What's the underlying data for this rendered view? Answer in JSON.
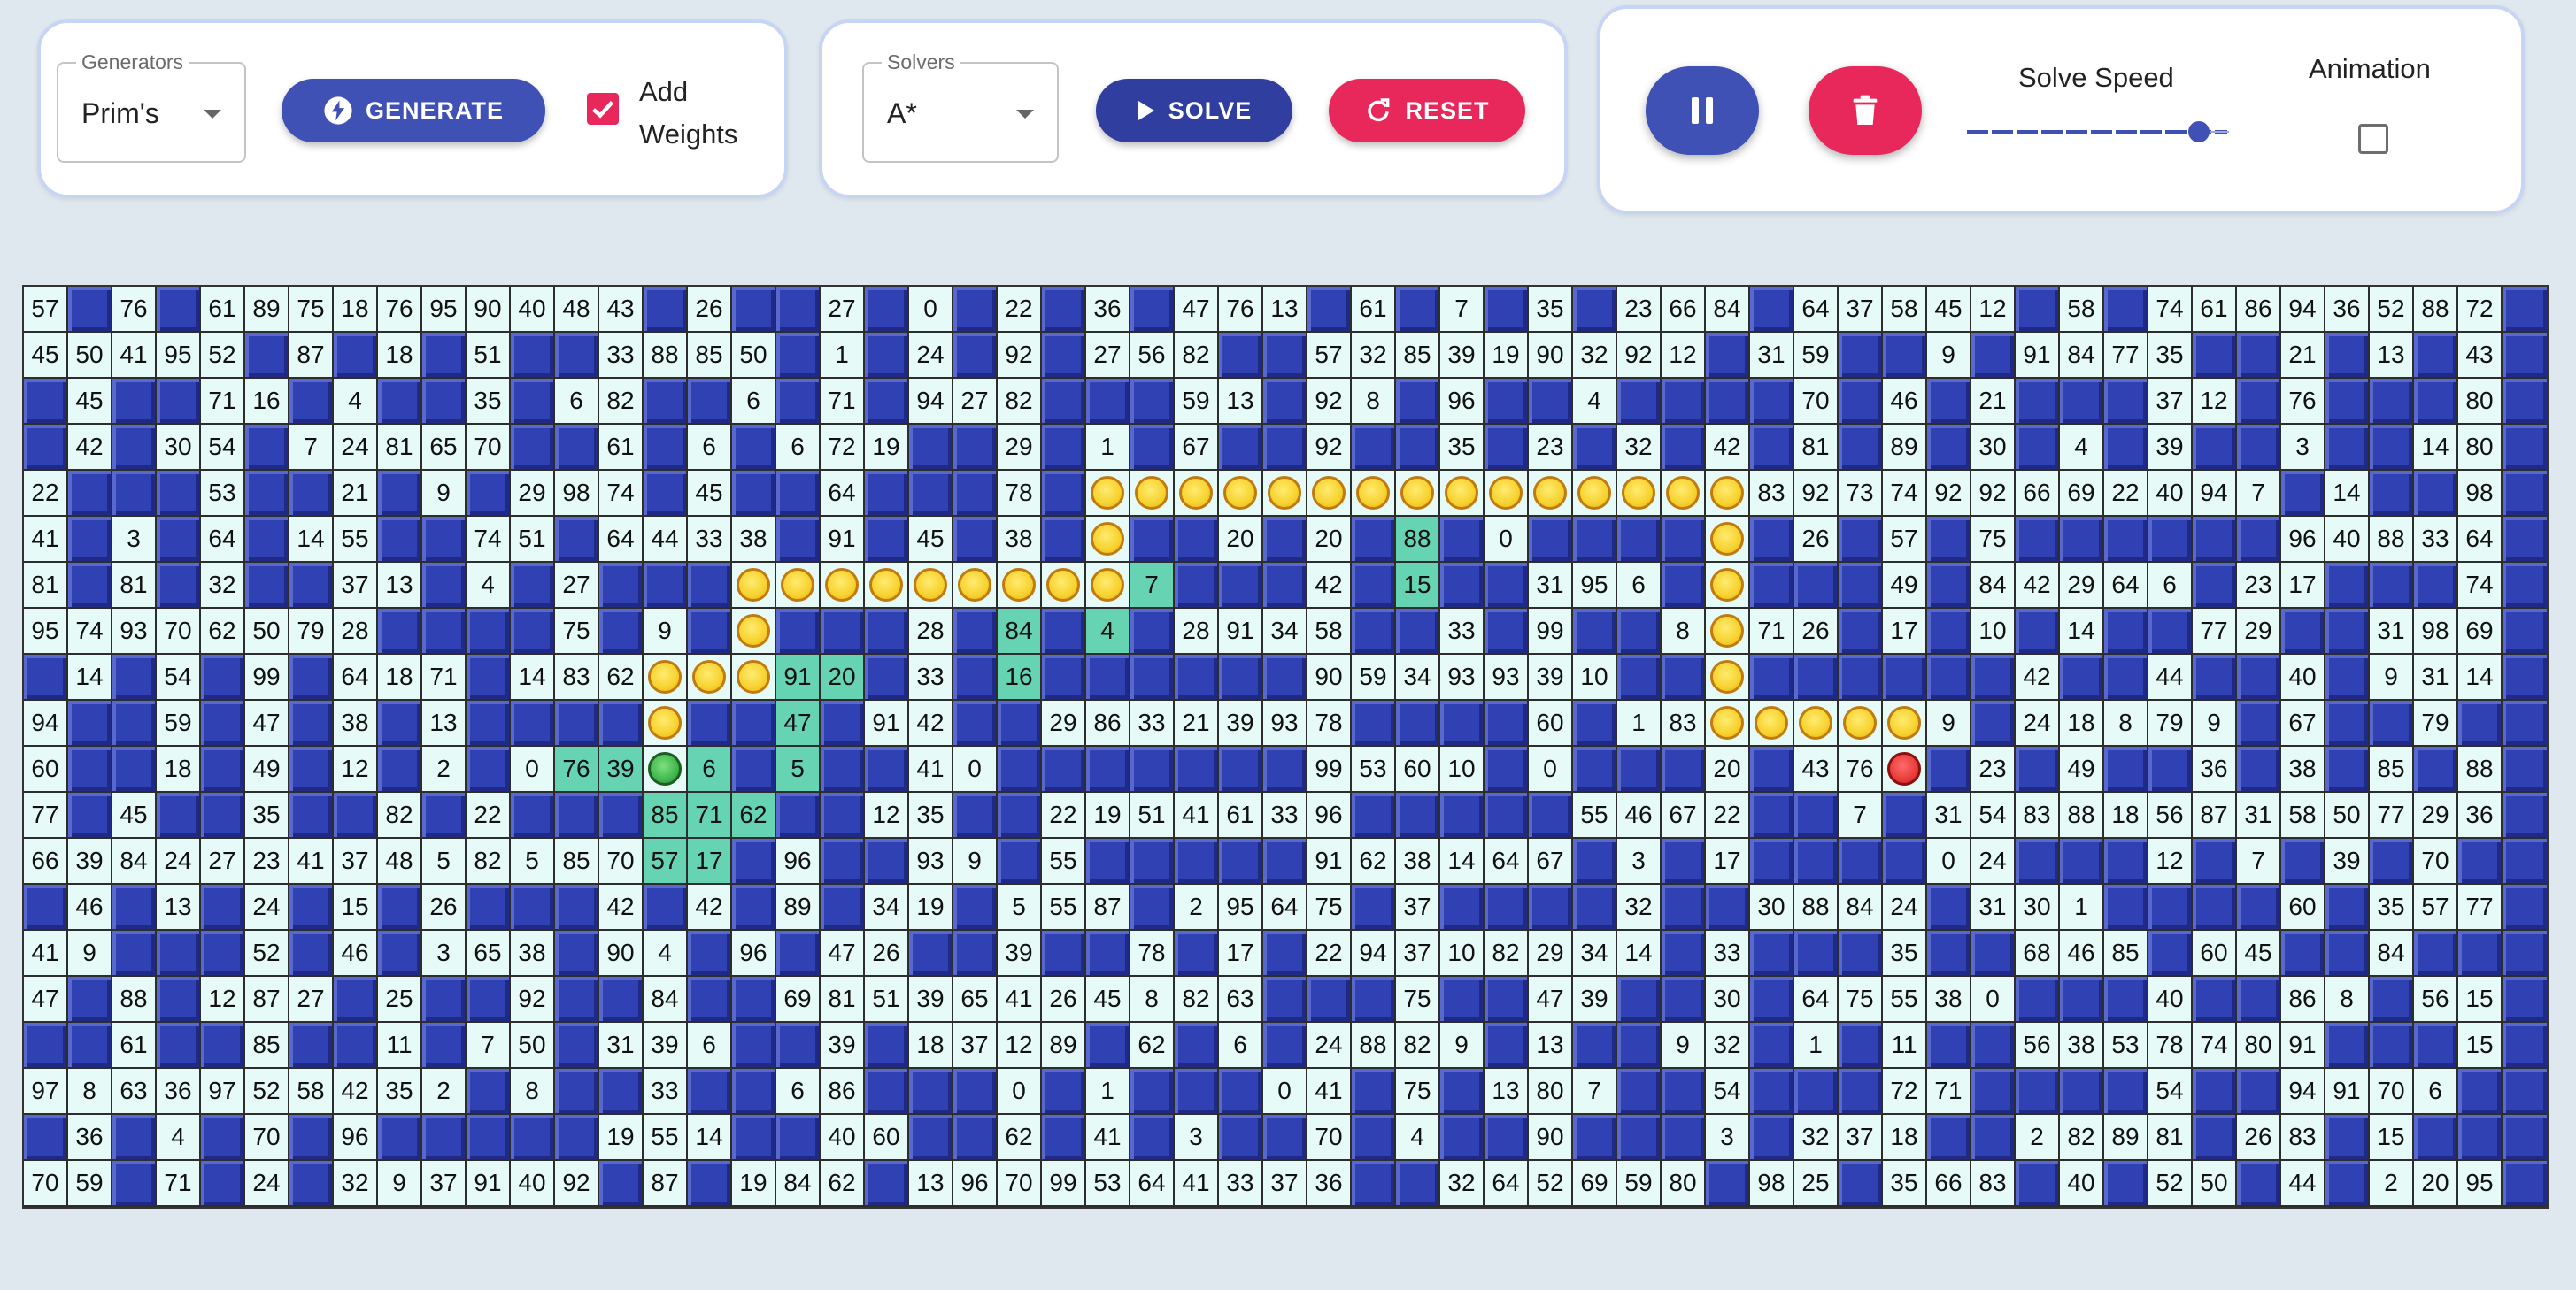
{
  "generators": {
    "legend": "Generators",
    "selected": "Prim's",
    "generate_label": "GENERATE",
    "add_weights_label_line1": "Add",
    "add_weights_label_line2": "Weights",
    "add_weights_checked": true
  },
  "solvers": {
    "legend": "Solvers",
    "selected": "A*",
    "solve_label": "SOLVE",
    "reset_label": "RESET"
  },
  "controls": {
    "pause_icon": "pause-icon",
    "delete_icon": "trash-icon",
    "solve_speed_label": "Solve Speed",
    "solve_speed_value": 0.93,
    "animation_label": "Animation",
    "animation_checked": false
  },
  "colors": {
    "primary": "#3f51b5",
    "secondary": "#e8285a",
    "wall": "#2f41b3",
    "open": "#e6fbf8",
    "visited": "#66d4b2",
    "path": "#f7d22e",
    "start": "#3db34a",
    "end": "#e53935"
  },
  "grid": {
    "cols": 57,
    "legend": {
      "#": "wall",
      "~": "visited cell",
      "o": "path marker",
      "S": "start",
      "E": "end"
    },
    "rows": [
      [
        "57",
        "#",
        "76",
        "#",
        "61",
        "89",
        "75",
        "18",
        "76",
        "95",
        "90",
        "40",
        "48",
        "43",
        "#",
        "26",
        "#",
        "#",
        "27",
        "#",
        "0",
        "#",
        "22",
        "#",
        "36",
        "#",
        "47",
        "76",
        "13",
        "#",
        "61",
        "#",
        "7",
        "#",
        "35",
        "#",
        "23",
        "66",
        "84",
        "#",
        "64",
        "37",
        "58",
        "45",
        "12",
        "#",
        "58",
        "#",
        "74",
        "61",
        "86",
        "94",
        "36",
        "52",
        "88",
        "72"
      ],
      [
        "45",
        "50",
        "41",
        "95",
        "52",
        "#",
        "87",
        "#",
        "18",
        "#",
        "51",
        "#",
        "#",
        "33",
        "88",
        "85",
        "50",
        "#",
        "1",
        "#",
        "24",
        "#",
        "92",
        "#",
        "27",
        "56",
        "82",
        "#",
        "#",
        "57",
        "32",
        "85",
        "39",
        "19",
        "90",
        "32",
        "92",
        "12",
        "#",
        "31",
        "59",
        "#",
        "#",
        "9",
        "#",
        "91",
        "84",
        "77",
        "35",
        "#",
        "#",
        "21",
        "#",
        "13",
        "#",
        "43"
      ],
      [
        "#",
        "45",
        "#",
        "#",
        "71",
        "16",
        "#",
        "4",
        "#",
        "#",
        "35",
        "#",
        "6",
        "82",
        "#",
        "#",
        "6",
        "#",
        "71",
        "#",
        "94",
        "27",
        "82",
        "#",
        "#",
        "#",
        "59",
        "13",
        "#",
        "92",
        "8",
        "#",
        "96",
        "#",
        "#",
        "4",
        "#",
        "#",
        "#",
        "#",
        "70",
        "#",
        "46",
        "#",
        "21",
        "#",
        "#",
        "#",
        "37",
        "12",
        "#",
        "76",
        "#",
        "#",
        "#",
        "80"
      ],
      [
        "#",
        "42",
        "#",
        "30",
        "54",
        "#",
        "7",
        "24",
        "81",
        "65",
        "70",
        "#",
        "#",
        "61",
        "#",
        "6",
        "#",
        "6",
        "72",
        "19",
        "#",
        "#",
        "29",
        "#",
        "1",
        "#",
        "67",
        "#",
        "#",
        "92",
        "#",
        "#",
        "35",
        "#",
        "23",
        "#",
        "32",
        "#",
        "42",
        "#",
        "81",
        "#",
        "89",
        "#",
        "30",
        "#",
        "4",
        "#",
        "39",
        "#",
        "#",
        "3",
        "#",
        "#",
        "14",
        "80"
      ],
      [
        "22",
        "#",
        "#",
        "#",
        "53",
        "#",
        "#",
        "21",
        "#",
        "9",
        "#",
        "29",
        "98",
        "74",
        "#",
        "45",
        "#",
        "#",
        "64",
        "#",
        "#",
        "#",
        "78",
        "#",
        "o",
        "o",
        "o",
        "o",
        "o",
        "o",
        "o",
        "o",
        "o",
        "o",
        "o",
        "o",
        "o",
        "o",
        "o",
        "83",
        "92",
        "73",
        "74",
        "92",
        "92",
        "66",
        "69",
        "22",
        "40",
        "94",
        "7",
        "#",
        "14",
        "#",
        "#",
        "98"
      ],
      [
        "41",
        "#",
        "3",
        "#",
        "64",
        "#",
        "14",
        "55",
        "#",
        "#",
        "74",
        "51",
        "#",
        "64",
        "44",
        "33",
        "38",
        "#",
        "91",
        "#",
        "45",
        "#",
        "38",
        "#",
        "o",
        "#",
        "#",
        "20",
        "#",
        "20",
        "#",
        "~88",
        "#",
        "0",
        "#",
        "#",
        "#",
        "#",
        "o",
        "#",
        "26",
        "#",
        "57",
        "#",
        "75",
        "#",
        "#",
        "#",
        "#",
        "#",
        "#",
        "96",
        "40",
        "88",
        "33",
        "64"
      ],
      [
        "81",
        "#",
        "81",
        "#",
        "32",
        "#",
        "#",
        "37",
        "13",
        "#",
        "4",
        "#",
        "27",
        "#",
        "#",
        "#",
        "o",
        "o",
        "o",
        "o",
        "o",
        "o",
        "o",
        "o",
        "o",
        "~7",
        "#",
        "#",
        "#",
        "42",
        "#",
        "~15",
        "#",
        "#",
        "31",
        "95",
        "6",
        "#",
        "o",
        "#",
        "#",
        "#",
        "49",
        "#",
        "84",
        "42",
        "29",
        "64",
        "6",
        "#",
        "23",
        "17",
        "#",
        "#",
        "#",
        "74"
      ],
      [
        "95",
        "74",
        "93",
        "70",
        "62",
        "50",
        "79",
        "28",
        "#",
        "#",
        "#",
        "#",
        "75",
        "#",
        "9",
        "#",
        "o",
        "#",
        "#",
        "#",
        "28",
        "#",
        "~84",
        "#",
        "~4",
        "#",
        "28",
        "91",
        "34",
        "58",
        "#",
        "#",
        "33",
        "#",
        "99",
        "#",
        "#",
        "8",
        "o",
        "71",
        "26",
        "#",
        "17",
        "#",
        "10",
        "#",
        "14",
        "#",
        "#",
        "77",
        "29",
        "#",
        "#",
        "31",
        "98",
        "69"
      ],
      [
        "#",
        "14",
        "#",
        "54",
        "#",
        "99",
        "#",
        "64",
        "18",
        "71",
        "#",
        "14",
        "83",
        "62",
        "o",
        "o",
        "o",
        "~91",
        "~20",
        "#",
        "33",
        "#",
        "~16",
        "#",
        "#",
        "#",
        "#",
        "#",
        "#",
        "90",
        "59",
        "34",
        "93",
        "93",
        "39",
        "10",
        "#",
        "#",
        "o",
        "#",
        "#",
        "#",
        "#",
        "#",
        "#",
        "42",
        "#",
        "#",
        "44",
        "#",
        "#",
        "40",
        "#",
        "9",
        "31",
        "14"
      ],
      [
        "94",
        "#",
        "#",
        "59",
        "#",
        "47",
        "#",
        "38",
        "#",
        "13",
        "#",
        "#",
        "#",
        "#",
        "o",
        "#",
        "#",
        "~47",
        "#",
        "91",
        "42",
        "#",
        "#",
        "29",
        "86",
        "33",
        "21",
        "39",
        "93",
        "78",
        "#",
        "#",
        "#",
        "#",
        "60",
        "#",
        "1",
        "83",
        "o",
        "o",
        "o",
        "o",
        "o",
        "9",
        "#",
        "24",
        "18",
        "8",
        "79",
        "9",
        "#",
        "67",
        "#",
        "#",
        "79",
        "#"
      ],
      [
        "60",
        "#",
        "#",
        "18",
        "#",
        "49",
        "#",
        "12",
        "#",
        "2",
        "#",
        "0",
        "~76",
        "~39",
        "S",
        "~6",
        "#",
        "~5",
        "#",
        "#",
        "41",
        "0",
        "#",
        "#",
        "#",
        "#",
        "#",
        "#",
        "#",
        "99",
        "53",
        "60",
        "10",
        "#",
        "0",
        "#",
        "#",
        "#",
        "20",
        "#",
        "43",
        "76",
        "E",
        "#",
        "23",
        "#",
        "49",
        "#",
        "#",
        "36",
        "#",
        "38",
        "#",
        "85",
        "#",
        "88"
      ],
      [
        "77",
        "#",
        "45",
        "#",
        "#",
        "35",
        "#",
        "#",
        "82",
        "#",
        "22",
        "#",
        "#",
        "#",
        "~85",
        "~71",
        "~62",
        "#",
        "#",
        "12",
        "35",
        "#",
        "#",
        "22",
        "19",
        "51",
        "41",
        "61",
        "33",
        "96",
        "#",
        "#",
        "#",
        "#",
        "#",
        "55",
        "46",
        "67",
        "22",
        "#",
        "#",
        "7",
        "#",
        "31",
        "54",
        "83",
        "88",
        "18",
        "56",
        "87",
        "31",
        "58",
        "50",
        "77",
        "29",
        "36"
      ],
      [
        "66",
        "39",
        "84",
        "24",
        "27",
        "23",
        "41",
        "37",
        "48",
        "5",
        "82",
        "5",
        "85",
        "70",
        "~57",
        "~17",
        "#",
        "96",
        "#",
        "#",
        "93",
        "9",
        "#",
        "55",
        "#",
        "#",
        "#",
        "#",
        "#",
        "91",
        "62",
        "38",
        "14",
        "64",
        "67",
        "#",
        "3",
        "#",
        "17",
        "#",
        "#",
        "#",
        "#",
        "0",
        "24",
        "#",
        "#",
        "#",
        "12",
        "#",
        "7",
        "#",
        "39",
        "#",
        "70",
        "#"
      ],
      [
        "#",
        "46",
        "#",
        "13",
        "#",
        "24",
        "#",
        "15",
        "#",
        "26",
        "#",
        "#",
        "#",
        "42",
        "#",
        "42",
        "#",
        "89",
        "#",
        "34",
        "19",
        "#",
        "5",
        "55",
        "87",
        "#",
        "2",
        "95",
        "64",
        "75",
        "#",
        "37",
        "#",
        "#",
        "#",
        "#",
        "32",
        "#",
        "#",
        "30",
        "88",
        "84",
        "24",
        "#",
        "31",
        "30",
        "1",
        "#",
        "#",
        "#",
        "#",
        "60",
        "#",
        "35",
        "57",
        "77"
      ],
      [
        "41",
        "9",
        "#",
        "#",
        "#",
        "52",
        "#",
        "46",
        "#",
        "3",
        "65",
        "38",
        "#",
        "90",
        "4",
        "#",
        "96",
        "#",
        "47",
        "26",
        "#",
        "#",
        "39",
        "#",
        "#",
        "78",
        "#",
        "17",
        "#",
        "22",
        "94",
        "37",
        "10",
        "82",
        "29",
        "34",
        "14",
        "#",
        "33",
        "#",
        "#",
        "#",
        "35",
        "#",
        "#",
        "68",
        "46",
        "85",
        "#",
        "60",
        "45",
        "#",
        "#",
        "84",
        "#"
      ],
      [
        "47",
        "#",
        "88",
        "#",
        "12",
        "87",
        "27",
        "#",
        "25",
        "#",
        "#",
        "92",
        "#",
        "#",
        "84",
        "#",
        "#",
        "69",
        "81",
        "51",
        "39",
        "65",
        "41",
        "26",
        "45",
        "8",
        "82",
        "63",
        "#",
        "#",
        "#",
        "75",
        "#",
        "#",
        "47",
        "39",
        "#",
        "#",
        "30",
        "#",
        "64",
        "75",
        "55",
        "38",
        "0",
        "#",
        "#",
        "#",
        "40",
        "#",
        "#",
        "86",
        "8",
        "#",
        "56",
        "15"
      ],
      [
        "#",
        "#",
        "61",
        "#",
        "#",
        "85",
        "#",
        "#",
        "11",
        "#",
        "7",
        "50",
        "#",
        "31",
        "39",
        "6",
        "#",
        "#",
        "39",
        "#",
        "18",
        "37",
        "12",
        "89",
        "#",
        "62",
        "#",
        "6",
        "#",
        "24",
        "88",
        "82",
        "9",
        "#",
        "13",
        "#",
        "#",
        "9",
        "32",
        "#",
        "1",
        "#",
        "11",
        "#",
        "#",
        "56",
        "38",
        "53",
        "78",
        "74",
        "80",
        "91",
        "#",
        "#",
        "#",
        "15"
      ],
      [
        "97",
        "8",
        "63",
        "36",
        "97",
        "52",
        "58",
        "42",
        "35",
        "2",
        "#",
        "8",
        "#",
        "#",
        "33",
        "#",
        "#",
        "6",
        "86",
        "#",
        "#",
        "#",
        "0",
        "#",
        "1",
        "#",
        "#",
        "#",
        "0",
        "41",
        "#",
        "75",
        "#",
        "13",
        "80",
        "7",
        "#",
        "#",
        "54",
        "#",
        "#",
        "#",
        "72",
        "71",
        "#",
        "#",
        "#",
        "#",
        "54",
        "#",
        "#",
        "94",
        "91",
        "70",
        "6",
        "#"
      ],
      [
        "#",
        "36",
        "#",
        "4",
        "#",
        "70",
        "#",
        "96",
        "#",
        "#",
        "#",
        "#",
        "#",
        "19",
        "55",
        "14",
        "#",
        "#",
        "40",
        "60",
        "#",
        "#",
        "62",
        "#",
        "41",
        "#",
        "3",
        "#",
        "#",
        "70",
        "#",
        "4",
        "#",
        "#",
        "90",
        "#",
        "#",
        "#",
        "3",
        "#",
        "32",
        "37",
        "18",
        "#",
        "#",
        "2",
        "82",
        "89",
        "81",
        "#",
        "26",
        "83",
        "#",
        "15",
        "#",
        "#"
      ],
      [
        "70",
        "59",
        "#",
        "71",
        "#",
        "24",
        "#",
        "32",
        "9",
        "37",
        "91",
        "40",
        "92",
        "#",
        "87",
        "#",
        "19",
        "84",
        "62",
        "#",
        "13",
        "96",
        "70",
        "99",
        "53",
        "64",
        "41",
        "33",
        "37",
        "36",
        "#",
        "#",
        "32",
        "64",
        "52",
        "69",
        "59",
        "80",
        "#",
        "98",
        "25",
        "#",
        "35",
        "66",
        "83",
        "#",
        "40",
        "#",
        "52",
        "50",
        "#",
        "44",
        "#",
        "2",
        "20",
        "95"
      ]
    ]
  }
}
